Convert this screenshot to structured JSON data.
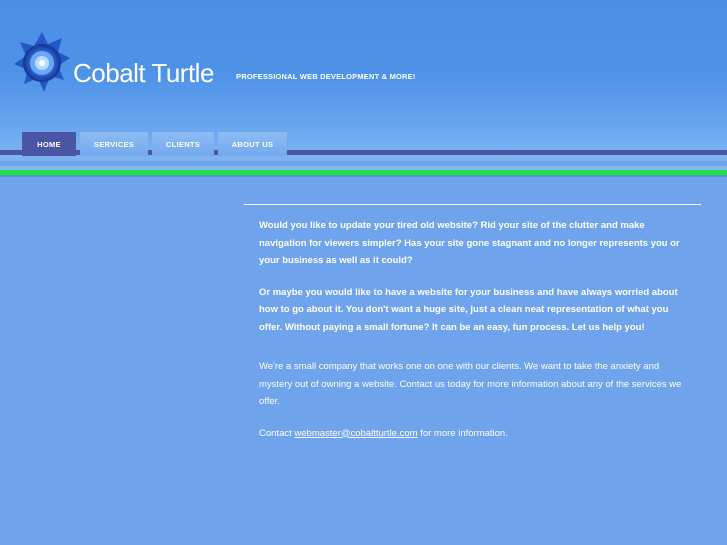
{
  "brand": {
    "name": "Cobalt Turtle",
    "tagline": "PROFESSIONAL WEB DEVELOPMENT & MORE!"
  },
  "nav": {
    "items": [
      {
        "label": "HOME",
        "active": true
      },
      {
        "label": "SERVICES",
        "active": false
      },
      {
        "label": "CLIENTS",
        "active": false
      },
      {
        "label": "ABOUT US",
        "active": false
      }
    ]
  },
  "content": {
    "p1": "Would you like to update your tired old website? Rid your site of the clutter and make navigation for viewers simpler? Has your site gone stagnant and no longer represents you or your business as well as it could?",
    "p2": "Or maybe you would like to have a website for your business and have always worried about how to go about it. You don't want a huge site, just a clean neat representation of what you offer. Without paying a small fortune? It can be an easy, fun process. Let us help you!",
    "p3": "We're a small company that works one on one with our clients. We want to take the anxiety and mystery out of owning a website. Contact us today for more information about any of the services we offer.",
    "contact_prefix": "Contact ",
    "contact_email": "webmaster@cobaltturtle.com",
    "contact_suffix": " for more information."
  },
  "colors": {
    "header_blue": "#4a8fe6",
    "body_blue": "#6fa4ec",
    "nav_active": "#4a55a6",
    "accent_green": "#1fe23f"
  },
  "icons": {
    "logo": "blue-emblem-icon"
  }
}
